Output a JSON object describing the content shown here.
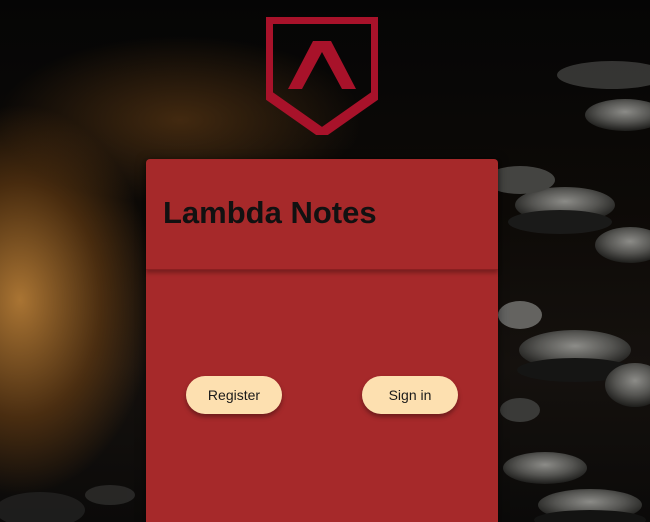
{
  "app": {
    "title": "Lambda Notes"
  },
  "actions": {
    "register_label": "Register",
    "signin_label": "Sign in"
  },
  "icons": {
    "logo": "lambda-shield-logo"
  },
  "colors": {
    "card_background": "#a6292a",
    "logo_red": "#a8122a",
    "button_background": "#fde0b0",
    "title_text": "#111111"
  }
}
